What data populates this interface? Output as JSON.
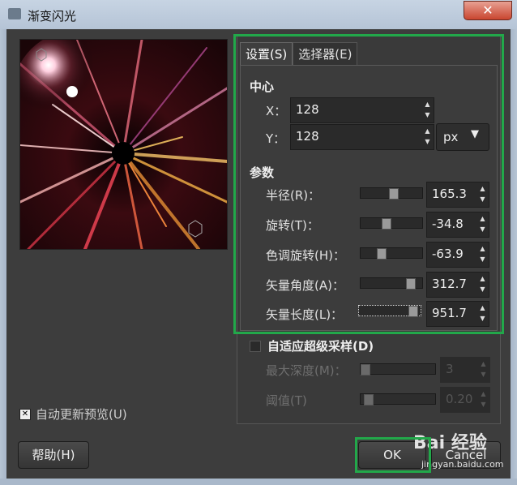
{
  "window": {
    "title": "渐变闪光",
    "close_glyph": "✕"
  },
  "tabs": [
    {
      "label": "设置(S)",
      "active": true
    },
    {
      "label": "选择器(E)",
      "active": false
    }
  ],
  "center": {
    "title": "中心",
    "x_label": "X：",
    "x_value": "128",
    "y_label": "Y：",
    "y_value": "128",
    "unit": "px"
  },
  "params": {
    "title": "参数",
    "rows": [
      {
        "label": "半径(R)：",
        "value": "165.3",
        "level": 0.55
      },
      {
        "label": "旋转(T)：",
        "value": "-34.8",
        "level": 0.4
      },
      {
        "label": "色调旋转(H)：",
        "value": "-63.9",
        "level": 0.32
      },
      {
        "label": "矢量角度(A)：",
        "value": "312.7",
        "level": 0.87
      },
      {
        "label": "矢量长度(L)：",
        "value": "951.7",
        "level": 0.95
      }
    ]
  },
  "supersampling": {
    "label": "自适应超级采样(D)",
    "max_depth_label": "最大深度(M)：",
    "max_depth_value": "3",
    "threshold_label": "阈值(T)",
    "threshold_value": "0.20"
  },
  "preview": {
    "auto_update_label": "自动更新预览(U)",
    "checked": true
  },
  "buttons": {
    "help": "帮助(H)",
    "ok": "OK",
    "cancel": "Cancel"
  },
  "watermark": {
    "logo": "Bai 经验",
    "url": "jingyan.baidu.com"
  },
  "colors": {
    "highlight": "#22a84a",
    "background": "#3d3d3d"
  }
}
